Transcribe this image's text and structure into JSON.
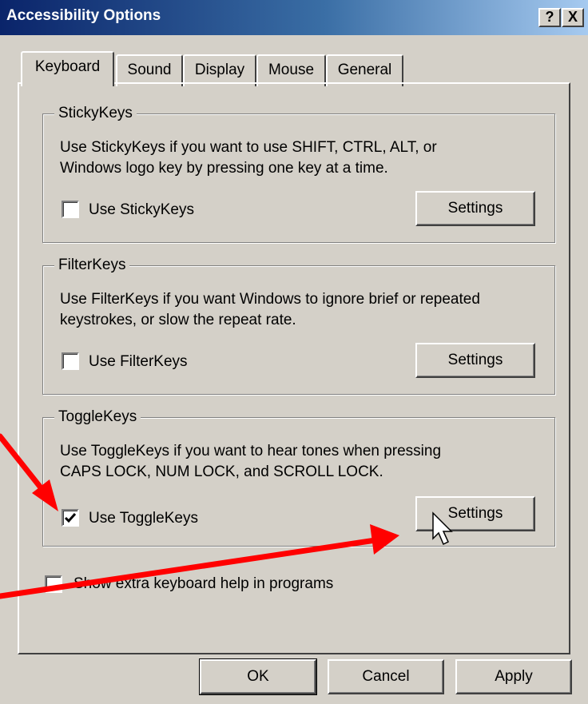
{
  "window": {
    "title": "Accessibility Options",
    "help_button": "?",
    "close_button": "X"
  },
  "tabs": [
    {
      "label": "Keyboard",
      "active": true
    },
    {
      "label": "Sound",
      "active": false
    },
    {
      "label": "Display",
      "active": false
    },
    {
      "label": "Mouse",
      "active": false
    },
    {
      "label": "General",
      "active": false
    }
  ],
  "groups": {
    "stickykeys": {
      "title": "StickyKeys",
      "description_line1": "Use StickyKeys if you want to use SHIFT, CTRL, ALT, or",
      "description_line2": "Windows logo key by pressing one key at a time.",
      "checkbox_label": "Use StickyKeys",
      "checked": false,
      "settings_label": "Settings"
    },
    "filterkeys": {
      "title": "FilterKeys",
      "description_line1": "Use FilterKeys if you want Windows to ignore brief or repeated",
      "description_line2": "keystrokes, or slow the repeat rate.",
      "checkbox_label": "Use FilterKeys",
      "checked": false,
      "settings_label": "Settings"
    },
    "togglekeys": {
      "title": "ToggleKeys",
      "description_line1": "Use ToggleKeys if you want to hear tones when pressing",
      "description_line2": "CAPS LOCK, NUM LOCK, and SCROLL LOCK.",
      "checkbox_label": "Use ToggleKeys",
      "checked": true,
      "settings_label": "Settings"
    }
  },
  "extra_help": {
    "checkbox_label": "Show extra keyboard help in programs",
    "checked": false
  },
  "footer": {
    "ok_label": "OK",
    "cancel_label": "Cancel",
    "apply_label": "Apply"
  },
  "colors": {
    "dialog_face": "#d4d0c8",
    "title_gradient_start": "#0a246a",
    "title_gradient_end": "#a6caf0",
    "annotation_arrow": "#ff0000"
  },
  "annotations": {
    "arrow_count": 2,
    "cursor": "arrow-pointer"
  }
}
